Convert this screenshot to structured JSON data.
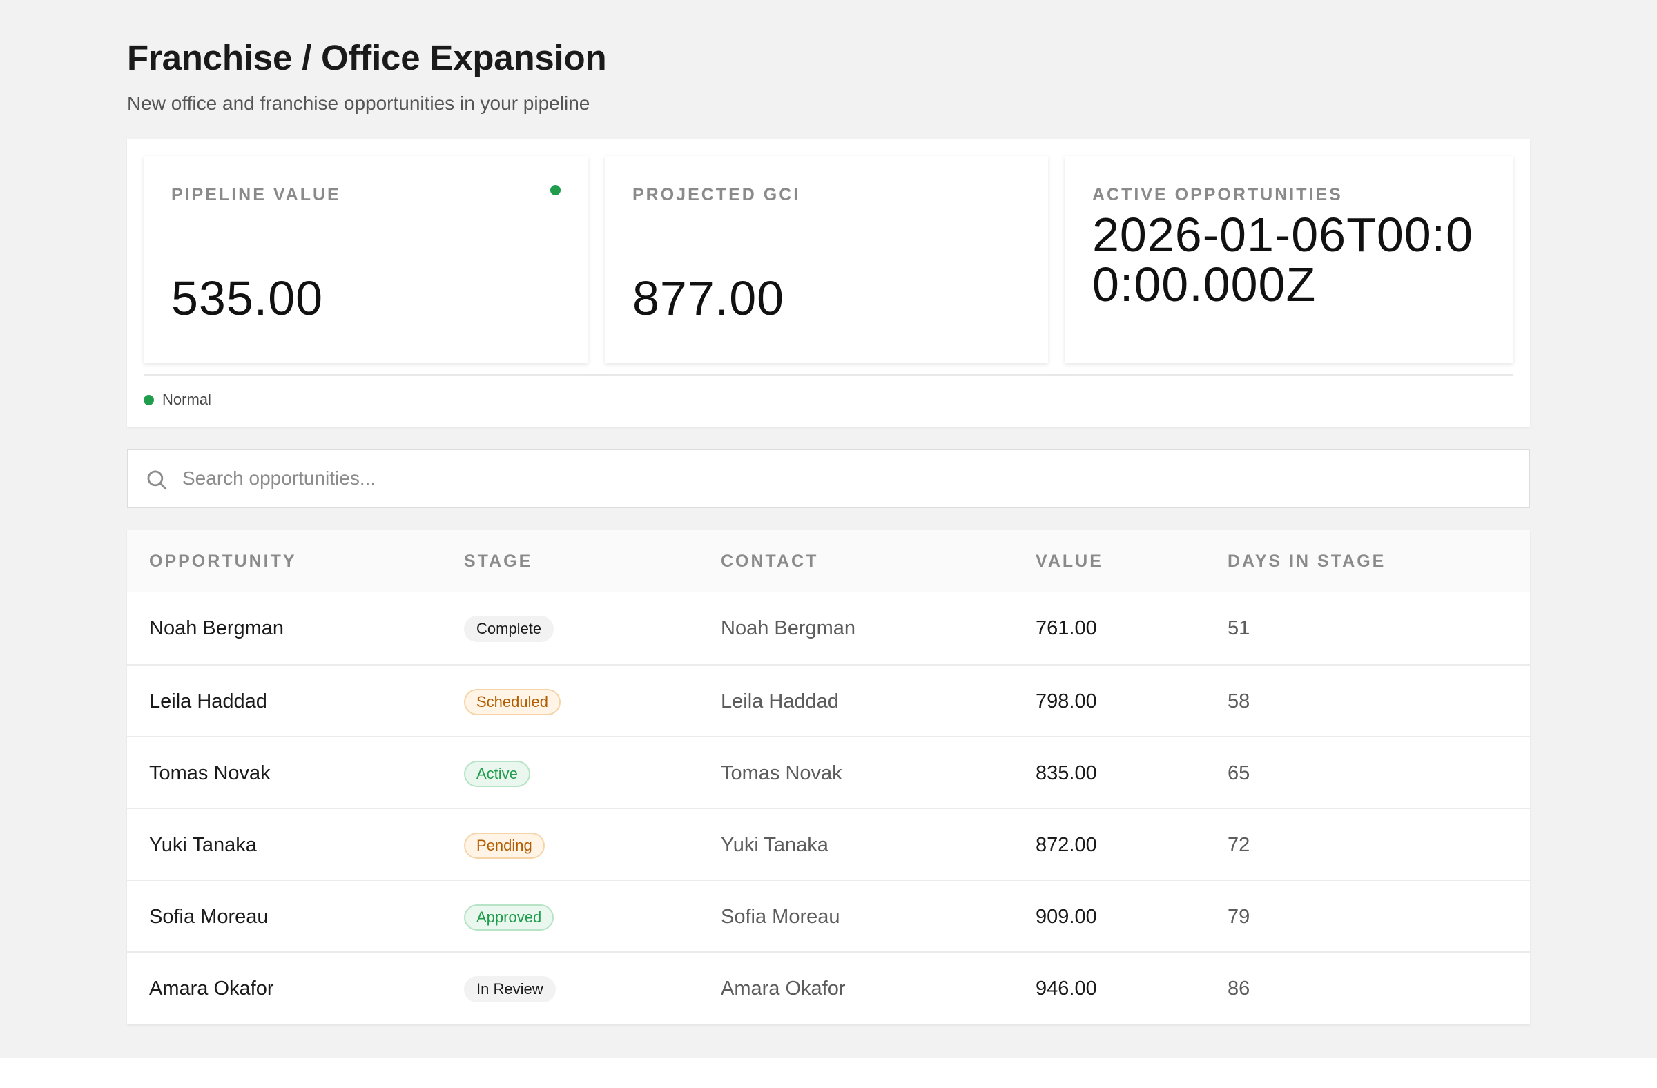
{
  "page": {
    "title": "Franchise / Office Expansion",
    "subtitle": "New office and franchise opportunities in your pipeline"
  },
  "metrics": [
    {
      "label": "PIPELINE VALUE",
      "value": "535.00"
    },
    {
      "label": "PROJECTED GCI",
      "value": "877.00"
    },
    {
      "label": "ACTIVE OPPORTUNITIES",
      "value": "2026-01-06T00:00:00.000Z"
    }
  ],
  "legend": {
    "label": "Normal",
    "color": "#1f9d4c"
  },
  "search": {
    "placeholder": "Search opportunities..."
  },
  "table": {
    "headers": [
      "OPPORTUNITY",
      "STAGE",
      "CONTACT",
      "VALUE",
      "DAYS IN STAGE"
    ],
    "rows": [
      {
        "opportunity": "Noah Bergman",
        "stage": "Complete",
        "contact": "Noah Bergman",
        "value": "761.00",
        "days": "51"
      },
      {
        "opportunity": "Leila Haddad",
        "stage": "Scheduled",
        "contact": "Leila Haddad",
        "value": "798.00",
        "days": "58"
      },
      {
        "opportunity": "Tomas Novak",
        "stage": "Active",
        "contact": "Tomas Novak",
        "value": "835.00",
        "days": "65"
      },
      {
        "opportunity": "Yuki Tanaka",
        "stage": "Pending",
        "contact": "Yuki Tanaka",
        "value": "872.00",
        "days": "72"
      },
      {
        "opportunity": "Sofia Moreau",
        "stage": "Approved",
        "contact": "Sofia Moreau",
        "value": "909.00",
        "days": "79"
      },
      {
        "opportunity": "Amara Okafor",
        "stage": "In Review",
        "contact": "Amara Okafor",
        "value": "946.00",
        "days": "86"
      }
    ]
  },
  "colors": {
    "success": "#1f9d4c",
    "warning": "#b35c00",
    "background": "#f2f2f2"
  }
}
